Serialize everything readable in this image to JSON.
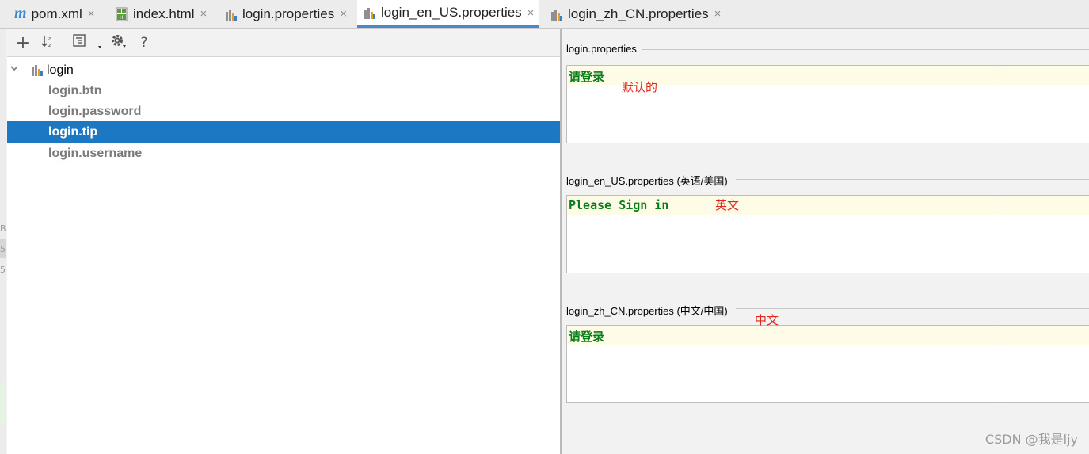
{
  "tabs": [
    {
      "label": "pom.xml",
      "icon": "maven-icon",
      "active": false
    },
    {
      "label": "index.html",
      "icon": "html-file-icon",
      "active": false
    },
    {
      "label": "login.properties",
      "icon": "resource-bundle-icon",
      "active": false
    },
    {
      "label": "login_en_US.properties",
      "icon": "resource-bundle-icon",
      "active": true
    },
    {
      "label": "login_zh_CN.properties",
      "icon": "resource-bundle-icon",
      "active": false
    }
  ],
  "tab_close_glyph": "×",
  "maven_glyph": "m",
  "toolbar": {
    "add_glyph": "+",
    "help_glyph": "?"
  },
  "tree": {
    "root": "login",
    "items": [
      "login.btn",
      "login.password",
      "login.tip",
      "login.username"
    ],
    "selected": "login.tip"
  },
  "gutter_marks": [
    "B",
    "5",
    "5"
  ],
  "sections": [
    {
      "label": "login.properties",
      "value": "请登录",
      "annotation": "默认的"
    },
    {
      "label": "login_en_US.properties (英语/美国)",
      "value": "Please Sign in",
      "annotation": "英文"
    },
    {
      "label": "login_zh_CN.properties (中文/中国)",
      "value": "请登录",
      "annotation": "中文"
    }
  ],
  "watermark": "CSDN @我是ljy",
  "colors": {
    "accent": "#4a88c7",
    "selection": "#1d78c4",
    "value_text": "#077d17",
    "annotation": "#e0281c",
    "line_highlight": "#fefbe7"
  }
}
